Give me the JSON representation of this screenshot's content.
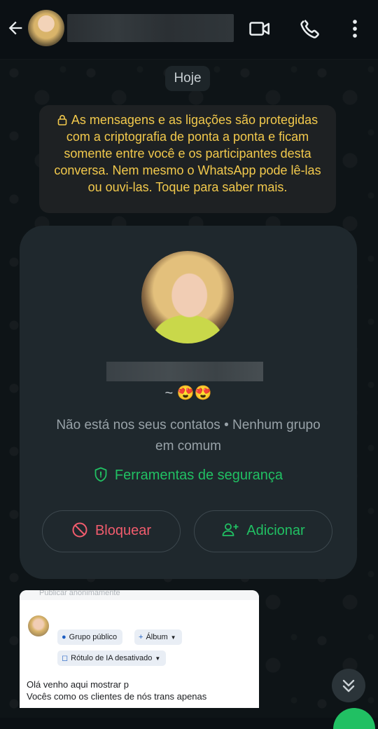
{
  "header": {
    "back_icon": "arrow-left-icon",
    "video_icon": "video-camera-icon",
    "call_icon": "phone-icon",
    "menu_icon": "more-vertical-icon"
  },
  "chat": {
    "date_label": "Hoje",
    "encryption_notice": "As mensagens e as ligações são protegidas com a criptografia de ponta a ponta e ficam somente entre você e os participantes desta conversa. Nem mesmo o WhatsApp pode lê-las ou ouvi-las. Toque para saber mais."
  },
  "contact_card": {
    "about": "~ 😍😍",
    "status": "Não está nos seus contatos • Nenhum grupo em comum",
    "security_tools": "Ferramentas de segurança",
    "block_label": "Bloquear",
    "add_label": "Adicionar"
  },
  "shared_post": {
    "top_text": "Publicar anonimamente",
    "chip_group": "Grupo público",
    "chip_album": "Álbum",
    "chip_ai": "Rótulo de IA desativado",
    "text_line1": "Olá venho aqui mostrar p",
    "text_line2": "Vocês como os clientes de nós trans apenas"
  },
  "colors": {
    "accent_green": "#21c063",
    "danger_red": "#f15c6d",
    "notice_yellow": "#f2c94c",
    "background": "#0b1014"
  }
}
